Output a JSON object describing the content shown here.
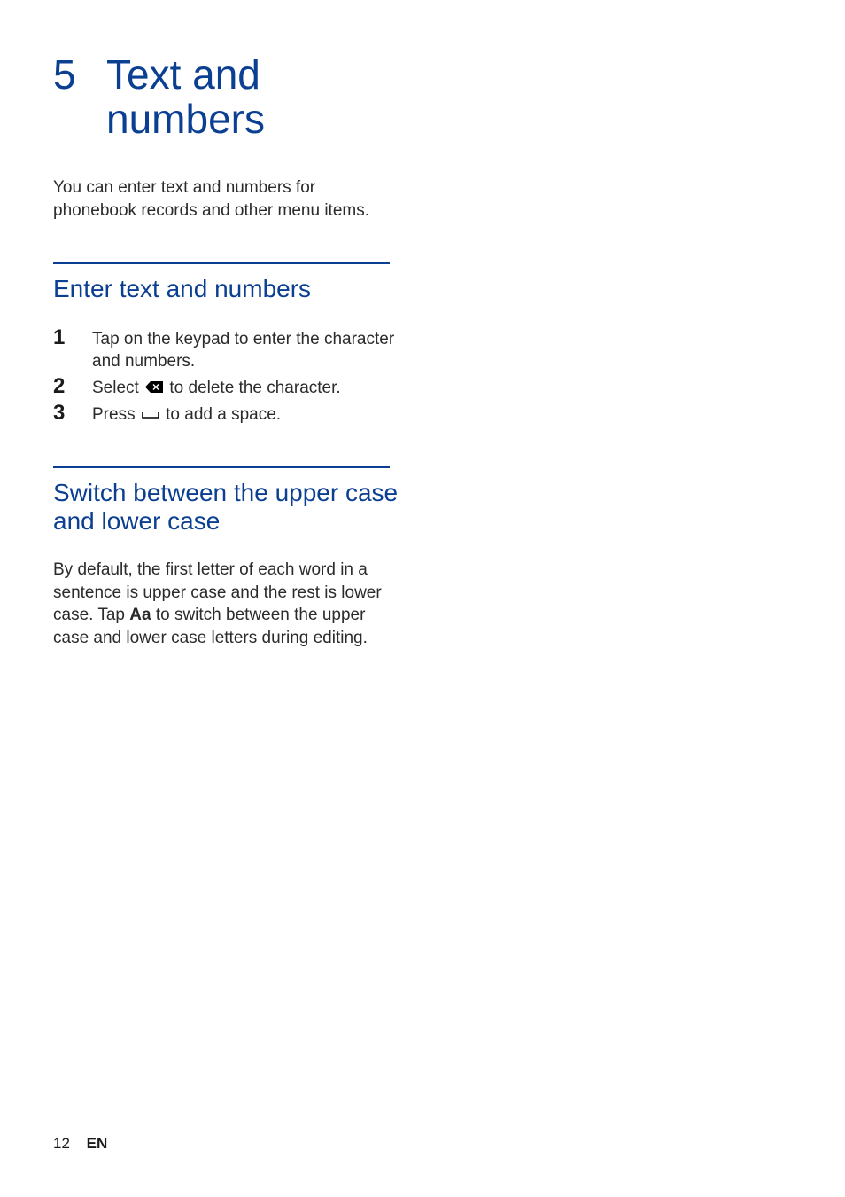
{
  "chapter": {
    "number": "5",
    "title": "Text and numbers"
  },
  "intro": "You can enter text and numbers for phonebook records and other menu items.",
  "section1": {
    "title": "Enter text and numbers",
    "steps": [
      {
        "n": "1",
        "pre": "Tap on the keypad to enter the character and numbers.",
        "post": ""
      },
      {
        "n": "2",
        "pre": "Select ",
        "post": " to delete the character."
      },
      {
        "n": "3",
        "pre": "Press ",
        "post": " to add a space."
      }
    ]
  },
  "section2": {
    "title": "Switch between the upper case and lower case",
    "body_pre": "By default, the first letter of each word in a sentence is upper case and the rest is lower case. Tap ",
    "body_bold": "Aa",
    "body_post": " to switch between the upper case and lower case letters during editing."
  },
  "footer": {
    "page": "12",
    "lang": "EN"
  }
}
